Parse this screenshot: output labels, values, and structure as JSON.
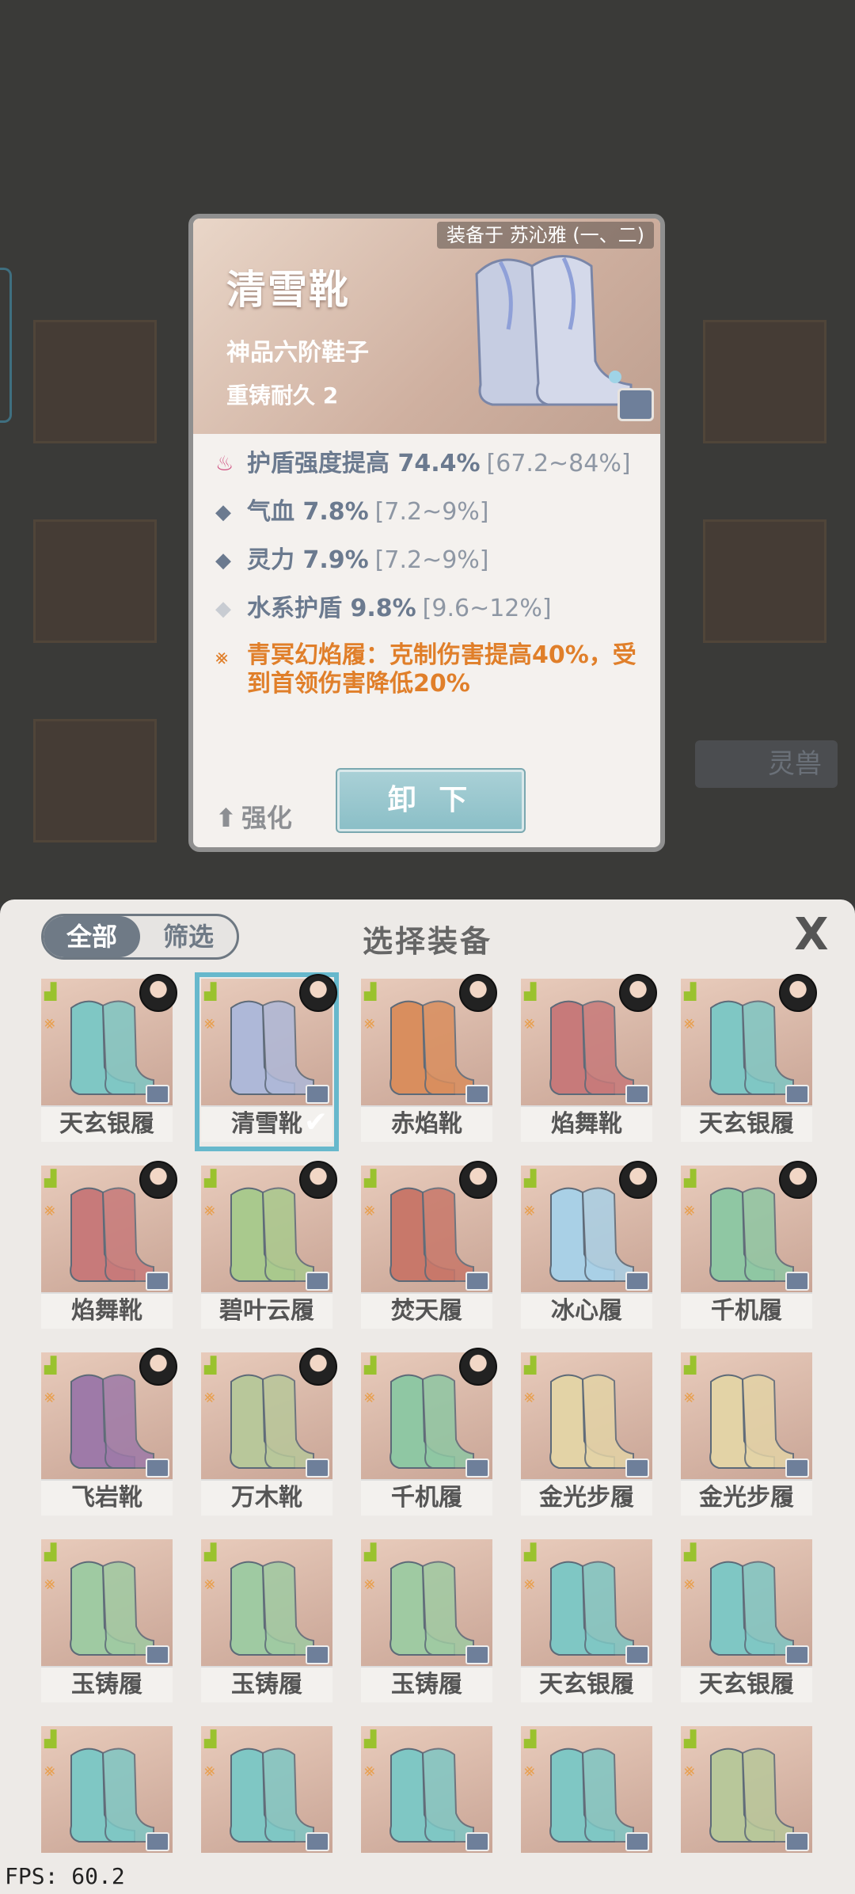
{
  "popup": {
    "owner": "装备于 苏沁雅 (一、二)",
    "name": "清雪靴",
    "grade": "神品六阶鞋子",
    "durability": "重铸耐久 2",
    "stats": [
      {
        "icon": "flame-icon",
        "name": "护盾强度提高 74.4%",
        "range": "[67.2~84%]",
        "color": "#d05080"
      },
      {
        "icon": "diamond-icon",
        "name": "气血 7.8%",
        "range": "[7.2~9%]",
        "color": "#6b7a8f"
      },
      {
        "icon": "diamond-icon",
        "name": "灵力 7.9%",
        "range": "[7.2~9%]",
        "color": "#6b7a8f"
      },
      {
        "icon": "diamond-light-icon",
        "name": "水系护盾 9.8%",
        "range": "[9.6~12%]",
        "color": "#c8ccd2"
      }
    ],
    "special": {
      "icon": "cross-rune-icon",
      "text": "青冥幻焰履：克制伤害提高40%，受到首领伤害降低20%"
    },
    "upgrade_label": "强化",
    "unequip_label": "卸 下"
  },
  "background": {
    "tab_label": "灵兽"
  },
  "panel": {
    "filter_all": "全部",
    "filter_screen": "筛选",
    "title": "选择装备",
    "close": "X"
  },
  "items": [
    {
      "name": "天玄银履",
      "color": "#7fc7c4",
      "avatar": true
    },
    {
      "name": "清雪靴",
      "color": "#aeb8d8",
      "avatar": true,
      "selected": true
    },
    {
      "name": "赤焰靴",
      "color": "#d98e5e",
      "avatar": true
    },
    {
      "name": "焰舞靴",
      "color": "#c77a7a",
      "avatar": true
    },
    {
      "name": "天玄银履",
      "color": "#7fc7c4",
      "avatar": true
    },
    {
      "name": "焰舞靴",
      "color": "#c77a7a",
      "avatar": true
    },
    {
      "name": "碧叶云履",
      "color": "#a9c98d",
      "avatar": true
    },
    {
      "name": "焚天履",
      "color": "#c8786a",
      "avatar": true
    },
    {
      "name": "冰心履",
      "color": "#a9d0e6",
      "avatar": true
    },
    {
      "name": "千机履",
      "color": "#8fc7a3",
      "avatar": true
    },
    {
      "name": "飞岩靴",
      "color": "#9e7aa8",
      "avatar": true
    },
    {
      "name": "万木靴",
      "color": "#b8c79a",
      "avatar": true
    },
    {
      "name": "千机履",
      "color": "#8fc7a3",
      "avatar": true
    },
    {
      "name": "金光步履",
      "color": "#e3d3a6",
      "avatar": false
    },
    {
      "name": "金光步履",
      "color": "#e3d3a6",
      "avatar": false
    },
    {
      "name": "玉铸履",
      "color": "#9fcaa2",
      "avatar": false
    },
    {
      "name": "玉铸履",
      "color": "#9fcaa2",
      "avatar": false
    },
    {
      "name": "玉铸履",
      "color": "#9fcaa2",
      "avatar": false
    },
    {
      "name": "天玄银履",
      "color": "#7fc7c4",
      "avatar": false
    },
    {
      "name": "天玄银履",
      "color": "#7fc7c4",
      "avatar": false
    },
    {
      "name": "",
      "color": "#7fc7c4",
      "avatar": false
    },
    {
      "name": "",
      "color": "#7fc7c4",
      "avatar": false
    },
    {
      "name": "",
      "color": "#7fc7c4",
      "avatar": false
    },
    {
      "name": "",
      "color": "#7fc7c4",
      "avatar": false
    },
    {
      "name": "",
      "color": "#b8c79a",
      "avatar": false
    }
  ],
  "fps": "FPS: 60.2"
}
